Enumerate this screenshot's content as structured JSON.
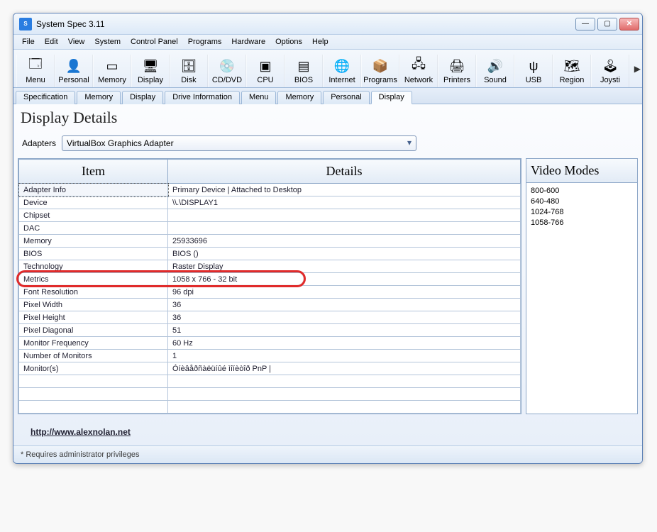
{
  "window": {
    "title": "System Spec 3.11"
  },
  "menubar": [
    "File",
    "Edit",
    "View",
    "System",
    "Control Panel",
    "Programs",
    "Hardware",
    "Options",
    "Help"
  ],
  "toolbar": [
    {
      "label": "Menu",
      "icon": "🗔"
    },
    {
      "label": "Personal",
      "icon": "👤"
    },
    {
      "label": "Memory",
      "icon": "▭"
    },
    {
      "label": "Display",
      "icon": "🖥"
    },
    {
      "label": "Disk",
      "icon": "🗄"
    },
    {
      "label": "CD/DVD",
      "icon": "💿"
    },
    {
      "label": "CPU",
      "icon": "▣"
    },
    {
      "label": "BIOS",
      "icon": "▤"
    },
    {
      "label": "Internet",
      "icon": "🌐"
    },
    {
      "label": "Programs",
      "icon": "📦"
    },
    {
      "label": "Network",
      "icon": "🖧"
    },
    {
      "label": "Printers",
      "icon": "🖨"
    },
    {
      "label": "Sound",
      "icon": "🔊"
    },
    {
      "label": "USB",
      "icon": "ψ"
    },
    {
      "label": "Region",
      "icon": "🗺"
    },
    {
      "label": "Joysti",
      "icon": "🕹"
    }
  ],
  "tabs": [
    {
      "label": "Specification",
      "active": false
    },
    {
      "label": "Memory",
      "active": false
    },
    {
      "label": "Display",
      "active": false
    },
    {
      "label": "Drive Information",
      "active": false
    },
    {
      "label": "Menu",
      "active": false
    },
    {
      "label": "Memory",
      "active": false
    },
    {
      "label": "Personal",
      "active": false
    },
    {
      "label": "Display",
      "active": true
    }
  ],
  "panel": {
    "title": "Display Details",
    "adapters_label": "Adapters",
    "adapter_selected": "VirtualBox Graphics Adapter"
  },
  "table": {
    "col_item": "Item",
    "col_details": "Details",
    "rows": [
      {
        "item": "Adapter Info",
        "details": "Primary Device | Attached to Desktop",
        "selected": true
      },
      {
        "item": "Device",
        "details": "\\\\.\\DISPLAY1"
      },
      {
        "item": "Chipset",
        "details": ""
      },
      {
        "item": "DAC",
        "details": ""
      },
      {
        "item": "Memory",
        "details": "25933696"
      },
      {
        "item": "BIOS",
        "details": "BIOS ()"
      },
      {
        "item": "Technology",
        "details": "Raster Display"
      },
      {
        "item": "Metrics",
        "details": "1058 x 766 - 32 bit",
        "highlight": true
      },
      {
        "item": "Font Resolution",
        "details": "96 dpi"
      },
      {
        "item": "Pixel Width",
        "details": "36"
      },
      {
        "item": "Pixel Height",
        "details": "36"
      },
      {
        "item": "Pixel Diagonal",
        "details": "51"
      },
      {
        "item": "Monitor Frequency",
        "details": "60 Hz"
      },
      {
        "item": "Number of Monitors",
        "details": "1"
      },
      {
        "item": "Monitor(s)",
        "details": "Óíèâåðñàëüíûé ìîíèòîð PnP |"
      }
    ]
  },
  "video_modes": {
    "header": "Video Modes",
    "items": [
      "800-600",
      "640-480",
      "1024-768",
      "1058-766"
    ]
  },
  "footer_link": "http://www.alexnolan.net",
  "statusbar": "*  Requires administrator privileges"
}
